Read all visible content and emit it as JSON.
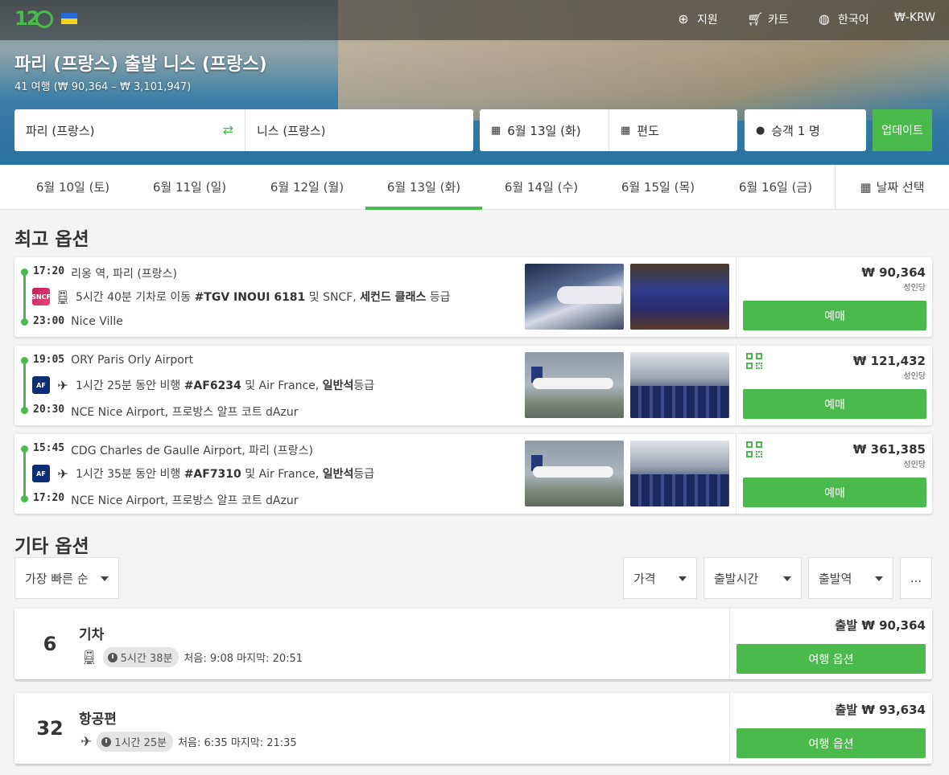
{
  "header": {
    "nav": [
      {
        "icon": "lifebuoy-icon",
        "label": "지원"
      },
      {
        "icon": "cart-icon",
        "label": "카트"
      },
      {
        "icon": "globe-icon",
        "label": "한국어"
      },
      {
        "icon": "currency-icon",
        "label": "₩-KRW"
      }
    ],
    "logo": "12Go"
  },
  "route": {
    "title": "파리 (프랑스) 출발 니스 (프랑스)",
    "subtitle": "41 여행 (₩ 90,364 – ₩ 3,101,947)"
  },
  "search": {
    "from": "파리 (프랑스)",
    "to": "니스 (프랑스)",
    "date": "6월 13일 (화)",
    "return": "편도",
    "passengers": "승객 1 명",
    "update_label": "업데이트"
  },
  "date_tabs": [
    "6월 10일 (토)",
    "6월 11일 (일)",
    "6월 12일 (월)",
    "6월 13일 (화)",
    "6월 14일 (수)",
    "6월 15일 (목)",
    "6월 16일 (금)"
  ],
  "active_date_index": 3,
  "date_pick_label": "날짜 선택",
  "best": {
    "heading": "최고 옵션",
    "items": [
      {
        "dep_time": "17:20",
        "dep_place": "리옹 역, 파리 (프랑스)",
        "arr_time": "23:00",
        "arr_place": "Nice Ville",
        "operator": "SNCF",
        "vehicle": "train",
        "desc_pre": "5시간 40분 기차로 이동 ",
        "desc_code": "#TGV INOUI 6181",
        "desc_mid": " 및 SNCF, ",
        "desc_class": "세컨드 클래스",
        "desc_post": " 등급",
        "price": "₩ 90,364",
        "per": "성인당",
        "book": "예매",
        "qr": false
      },
      {
        "dep_time": "19:05",
        "dep_place": "ORY Paris Orly Airport",
        "arr_time": "20:30",
        "arr_place": "NCE Nice Airport, 프로방스 알프 코트 dAzur",
        "operator": "AF",
        "vehicle": "plane",
        "desc_pre": "1시간 25분 동안 비행 ",
        "desc_code": "#AF6234",
        "desc_mid": " 및 Air France, ",
        "desc_class": "일반석",
        "desc_post": "등급",
        "price": "₩ 121,432",
        "per": "성인당",
        "book": "예매",
        "qr": true
      },
      {
        "dep_time": "15:45",
        "dep_place": "CDG Charles de Gaulle Airport, 파리 (프랑스)",
        "arr_time": "17:20",
        "arr_place": "NCE Nice Airport, 프로방스 알프 코트 dAzur",
        "operator": "AF",
        "vehicle": "plane",
        "desc_pre": "1시간 35분 동안 비행 ",
        "desc_code": "#AF7310",
        "desc_mid": " 및 Air France, ",
        "desc_class": "일반석",
        "desc_post": "등급",
        "price": "₩ 361,385",
        "per": "성인당",
        "book": "예매",
        "qr": true
      }
    ]
  },
  "other": {
    "heading": "기타 옵션",
    "sort": "가장 빠른 순",
    "filters": [
      "가격",
      "출발시간",
      "출발역"
    ],
    "more": "...",
    "items": [
      {
        "count": "6",
        "label": "기차",
        "vehicle": "train",
        "duration": "5시간 38분",
        "times": "처음: 9:08 마지막: 20:51",
        "price": "출발 ₩ 90,364",
        "button": "여행 옵션"
      },
      {
        "count": "32",
        "label": "항공편",
        "vehicle": "plane",
        "duration": "1시간 25분",
        "times": "처음: 6:35 마지막: 21:35",
        "price": "출발 ₩ 93,634",
        "button": "여행 옵션"
      }
    ]
  },
  "colors": {
    "accent": "#4bba4c",
    "text": "#333333",
    "background": "#f4f4f4"
  }
}
